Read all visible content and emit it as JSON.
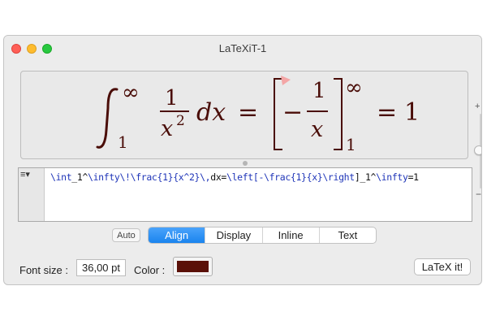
{
  "window": {
    "title": "LaTeXiT-1"
  },
  "preview": {
    "int_lower": "1",
    "int_upper": "∞",
    "frac1_num": "1",
    "frac1_den_base": "x",
    "frac1_den_exp": "2",
    "dx": "dx",
    "equals1": "=",
    "minus": "−",
    "frac2_num": "1",
    "frac2_den": "x",
    "bracket_lower": "1",
    "bracket_upper": "∞",
    "equals2": "=",
    "result": "1",
    "color": "#4a0d08"
  },
  "slider": {
    "plus": "+",
    "minus": "−"
  },
  "editor": {
    "menu_icon": "≡▾",
    "tokens": [
      "\\int",
      "_1^",
      "\\infty",
      "\\!",
      "\\frac",
      "{1}{x^2}",
      "\\,",
      "dx=",
      "\\left",
      "[-",
      "\\frac",
      "{1}{x}",
      "\\right",
      "]_1^",
      "\\infty",
      "=1"
    ]
  },
  "modes": {
    "auto_label": "Auto",
    "align": "Align",
    "display": "Display",
    "inline": "Inline",
    "text": "Text",
    "active": "Align"
  },
  "footer": {
    "font_size_label": "Font size :",
    "font_size_value": "36,00 pt",
    "color_label": "Color :",
    "color_value": "#5a1008",
    "latex_button": "LaTeX it!"
  }
}
